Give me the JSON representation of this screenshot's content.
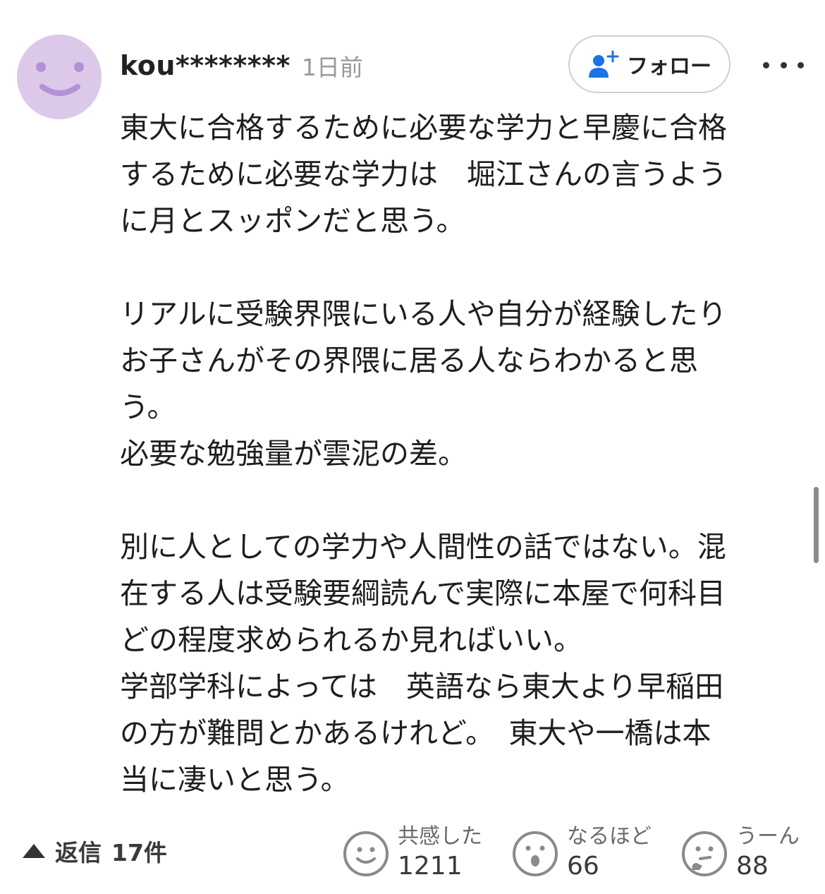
{
  "comment": {
    "username": "kou********",
    "timestamp": "1日前",
    "follow_label": "フォロー",
    "body_lines": [
      "東大に合格するために必要な学力と早慶に合格",
      "するために必要な学力は　堀江さんの言うよう",
      "に月とスッポンだと思う。",
      "",
      "リアルに受験界隈にいる人や自分が経験したり",
      "お子さんがその界隈に居る人ならわかると思",
      "う。",
      "必要な勉強量が雲泥の差。",
      "",
      "別に人としての学力や人間性の話ではない。混",
      "在する人は受験要綱読んで実際に本屋で何科目",
      "どの程度求められるか見ればいい。",
      "学部学科によっては　英語なら東大より早稲田",
      "の方が難問とかあるけれど。　東大や一橋は本",
      "当に凄いと思う。"
    ]
  },
  "footer": {
    "reply_label": "返信",
    "reply_count": "17件",
    "reactions": [
      {
        "label": "共感した",
        "count": "1211",
        "icon": "smile-icon"
      },
      {
        "label": "なるほど",
        "count": "66",
        "icon": "surprised-icon"
      },
      {
        "label": "うーん",
        "count": "88",
        "icon": "thinking-icon"
      }
    ]
  },
  "colors": {
    "avatar_bg": "#dcc9ea",
    "avatar_face": "#b490d4",
    "follow_icon": "#1a73e8",
    "text": "#1e1e1e",
    "muted": "#9a9a9a"
  }
}
